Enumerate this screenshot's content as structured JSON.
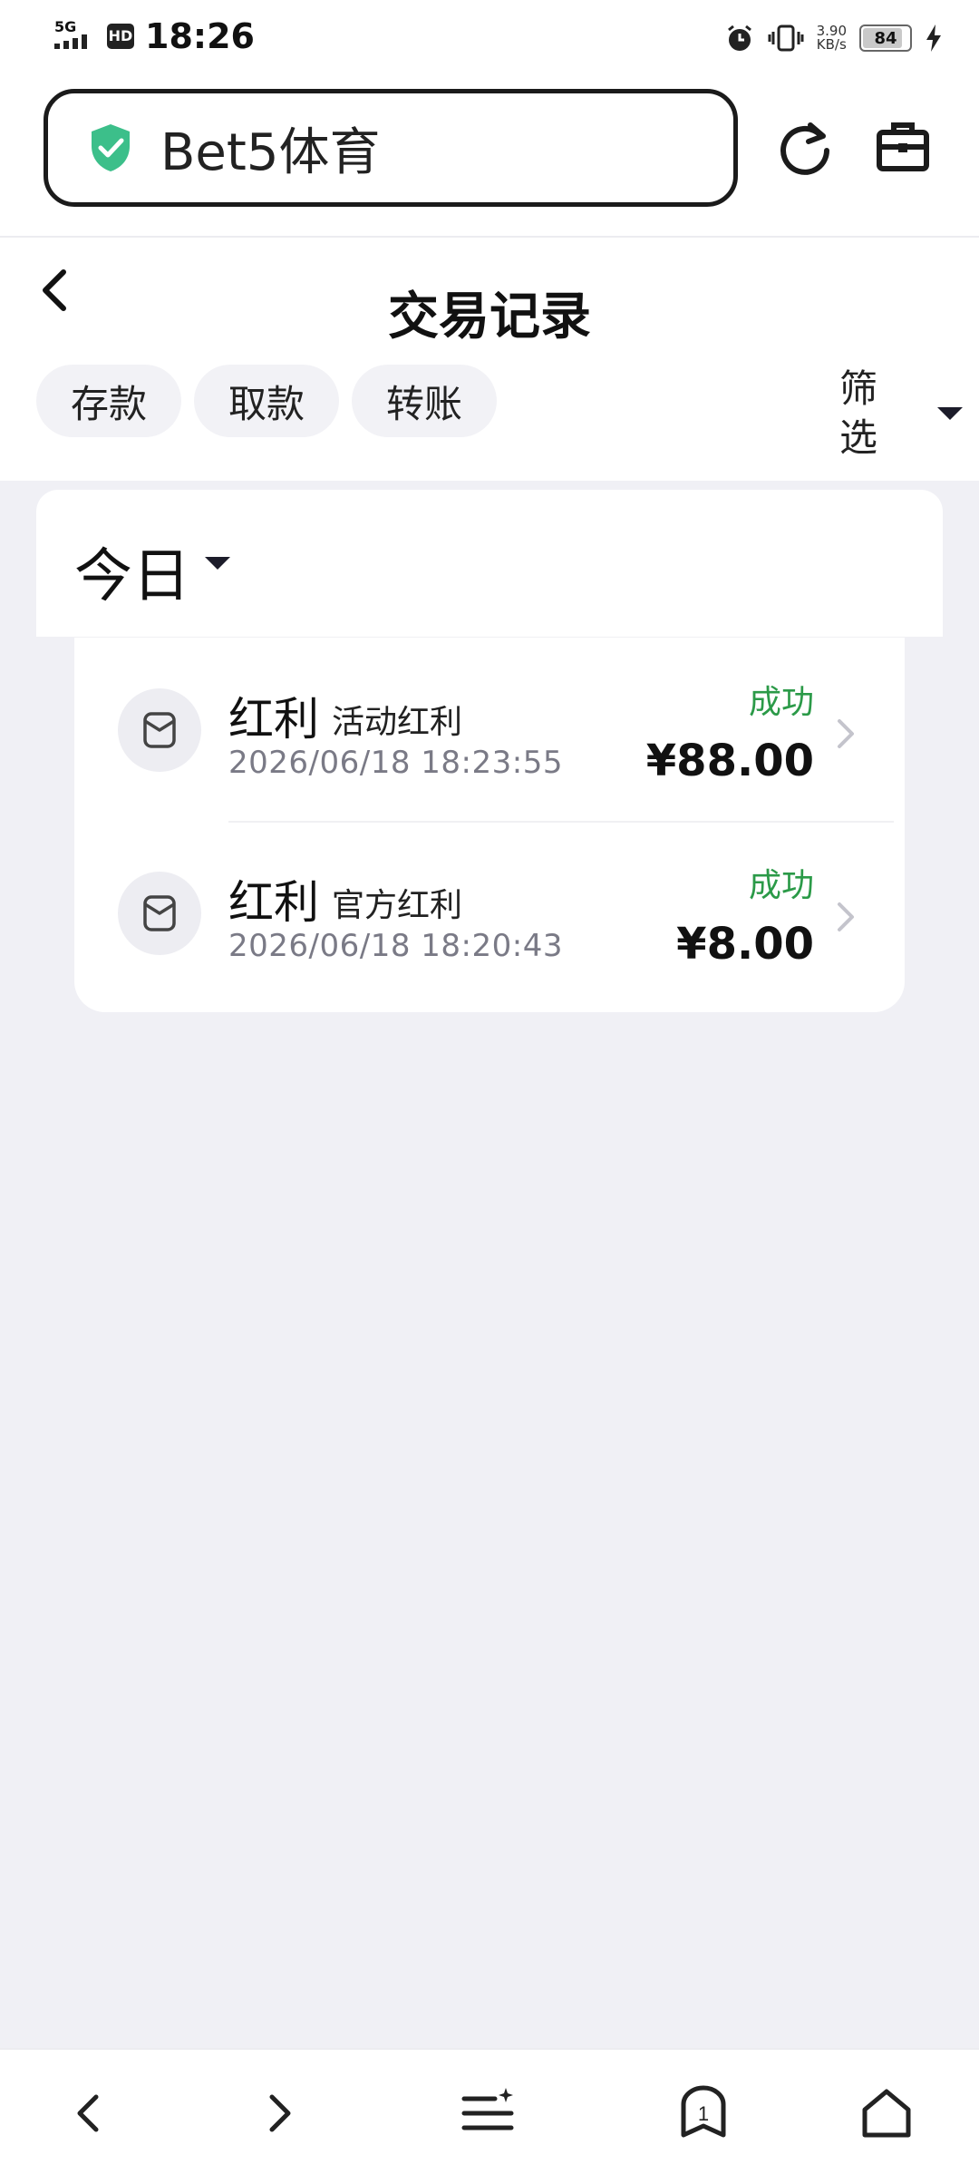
{
  "status_bar": {
    "network": "5G",
    "hd_badge": "HD",
    "time": "18:26",
    "speed_value": "3.90",
    "speed_unit": "KB/s",
    "battery": "84",
    "icons": [
      "signal-icon",
      "alarm-icon",
      "vibrate-icon",
      "charging-icon"
    ]
  },
  "browser": {
    "url_text": "Bet5体育",
    "shield_color": "#3cbf8a",
    "icons": [
      "shield-check-icon",
      "refresh-icon",
      "toolbox-icon"
    ]
  },
  "page": {
    "title": "交易记录",
    "tabs": [
      "存款",
      "取款",
      "转账"
    ],
    "filter_label": "筛选",
    "period": "今日"
  },
  "transactions": [
    {
      "type": "红利",
      "subtype": "活动红利",
      "timestamp": "2026/06/18 18:23:55",
      "status": "成功",
      "amount": "¥88.00"
    },
    {
      "type": "红利",
      "subtype": "官方红利",
      "timestamp": "2026/06/18 18:20:43",
      "status": "成功",
      "amount": "¥8.00"
    }
  ],
  "colors": {
    "success": "#2b9a48",
    "background": "#f0f0f5"
  },
  "bottom_nav": {
    "tab_count": "1",
    "icons": [
      "back-arrow-icon",
      "forward-arrow-icon",
      "menu-icon",
      "tabs-icon",
      "home-icon"
    ]
  }
}
